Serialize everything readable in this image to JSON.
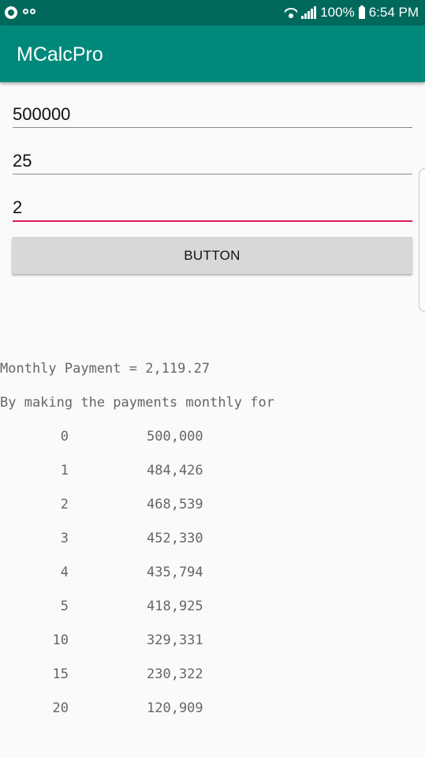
{
  "status_bar": {
    "battery": "100%",
    "time": "6:54 PM",
    "icons": [
      "app-circle-icon",
      "voicemail-icon",
      "wifi-icon",
      "signal-icon",
      "battery-icon"
    ]
  },
  "app_bar": {
    "title": "MCalcPro",
    "color": "#00897b"
  },
  "inputs": {
    "principal": "500000",
    "years": "25",
    "interest": "2",
    "focus_color": "#d81b60"
  },
  "button": {
    "label": "BUTTON"
  },
  "results": {
    "monthly_payment": "Monthly Payment = 2,119.27",
    "schedule_heading": "By making the payments monthly for",
    "rows": [
      {
        "year": "0",
        "balance": "500,000"
      },
      {
        "year": "1",
        "balance": "484,426"
      },
      {
        "year": "2",
        "balance": "468,539"
      },
      {
        "year": "3",
        "balance": "452,330"
      },
      {
        "year": "4",
        "balance": "435,794"
      },
      {
        "year": "5",
        "balance": "418,925"
      },
      {
        "year": "10",
        "balance": "329,331"
      },
      {
        "year": "15",
        "balance": "230,322"
      },
      {
        "year": "20",
        "balance": "120,909"
      }
    ]
  }
}
